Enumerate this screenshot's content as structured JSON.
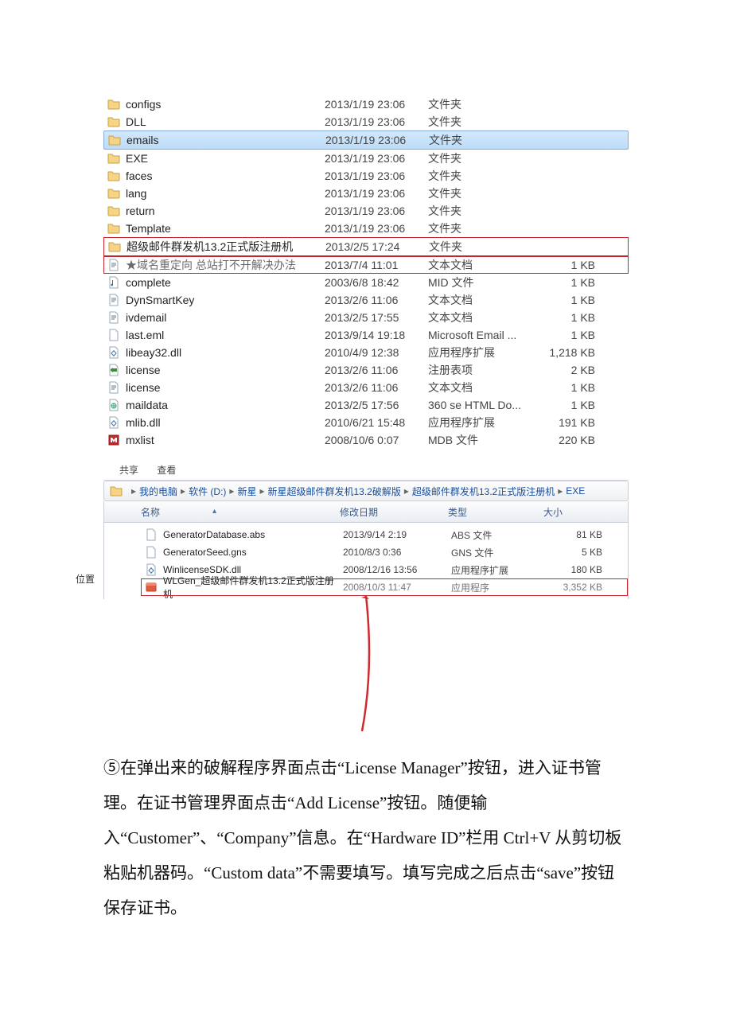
{
  "list1": {
    "rows": [
      {
        "icon": "folder",
        "name": "configs",
        "date": "2013/1/19 23:06",
        "type": "文件夹",
        "size": ""
      },
      {
        "icon": "folder",
        "name": "DLL",
        "date": "2013/1/19 23:06",
        "type": "文件夹",
        "size": ""
      },
      {
        "icon": "folder",
        "name": "emails",
        "date": "2013/1/19 23:06",
        "type": "文件夹",
        "size": "",
        "selected": true
      },
      {
        "icon": "folder",
        "name": "EXE",
        "date": "2013/1/19 23:06",
        "type": "文件夹",
        "size": ""
      },
      {
        "icon": "folder",
        "name": "faces",
        "date": "2013/1/19 23:06",
        "type": "文件夹",
        "size": ""
      },
      {
        "icon": "folder",
        "name": "lang",
        "date": "2013/1/19 23:06",
        "type": "文件夹",
        "size": ""
      },
      {
        "icon": "folder",
        "name": "return",
        "date": "2013/1/19 23:06",
        "type": "文件夹",
        "size": ""
      },
      {
        "icon": "folder",
        "name": "Template",
        "date": "2013/1/19 23:06",
        "type": "文件夹",
        "size": ""
      },
      {
        "icon": "folder",
        "name": "超级邮件群发机13.2正式版注册机",
        "date": "2013/2/5 17:24",
        "type": "文件夹",
        "size": "",
        "redbox": true
      },
      {
        "icon": "text",
        "name": "★域名重定向 总站打不开解决办法",
        "date": "2013/7/4 11:01",
        "type": "文本文档",
        "size": "1 KB",
        "boxed": true
      },
      {
        "icon": "midi",
        "name": "complete",
        "date": "2003/6/8 18:42",
        "type": "MID 文件",
        "size": "1 KB"
      },
      {
        "icon": "text",
        "name": "DynSmartKey",
        "date": "2013/2/6 11:06",
        "type": "文本文档",
        "size": "1 KB"
      },
      {
        "icon": "text",
        "name": "ivdemail",
        "date": "2013/2/5 17:55",
        "type": "文本文档",
        "size": "1 KB"
      },
      {
        "icon": "file",
        "name": "last.eml",
        "date": "2013/9/14 19:18",
        "type": "Microsoft Email ...",
        "size": "1 KB"
      },
      {
        "icon": "dll",
        "name": "libeay32.dll",
        "date": "2010/4/9 12:38",
        "type": "应用程序扩展",
        "size": "1,218 KB"
      },
      {
        "icon": "reg",
        "name": "license",
        "date": "2013/2/6 11:06",
        "type": "注册表项",
        "size": "2 KB"
      },
      {
        "icon": "text",
        "name": "license",
        "date": "2013/2/6 11:06",
        "type": "文本文档",
        "size": "1 KB"
      },
      {
        "icon": "html",
        "name": "maildata",
        "date": "2013/2/5 17:56",
        "type": "360 se HTML Do...",
        "size": "1 KB"
      },
      {
        "icon": "dll",
        "name": "mlib.dll",
        "date": "2010/6/21 15:48",
        "type": "应用程序扩展",
        "size": "191 KB"
      },
      {
        "icon": "mdb",
        "name": "mxlist",
        "date": "2008/10/6 0:07",
        "type": "MDB 文件",
        "size": "220 KB"
      }
    ]
  },
  "toolbar": {
    "share": "共享",
    "view": "查看",
    "breadcrumb": [
      "我的电脑",
      "软件 (D:)",
      "新星",
      "新星超级邮件群发机13.2破解版",
      "超级邮件群发机13.2正式版注册机",
      "EXE"
    ]
  },
  "list2": {
    "side_label": "位置",
    "headers": {
      "name": "名称",
      "date": "修改日期",
      "type": "类型",
      "size": "大小"
    },
    "rows": [
      {
        "icon": "file",
        "name": "GeneratorDatabase.abs",
        "date": "2013/9/14 2:19",
        "type": "ABS 文件",
        "size": "81 KB"
      },
      {
        "icon": "file",
        "name": "GeneratorSeed.gns",
        "date": "2010/8/3 0:36",
        "type": "GNS 文件",
        "size": "5 KB"
      },
      {
        "icon": "dll",
        "name": "WinlicenseSDK.dll",
        "date": "2008/12/16 13:56",
        "type": "应用程序扩展",
        "size": "180 KB"
      },
      {
        "icon": "exe-red",
        "name": "WLGen_超级邮件群发机13.2正式版注册机",
        "date": "2008/10/3 11:47",
        "type": "应用程序",
        "size": "3,352 KB",
        "redbox": true
      }
    ]
  },
  "paragraph": "⑤在弹出来的破解程序界面点击“License Manager”按钮，进入证书管理。在证书管理界面点击“Add License”按钮。随便输入“Customer”、“Company”信息。在“Hardware ID”栏用 Ctrl+V 从剪切板粘贴机器码。“Custom data”不需要填写。填写完成之后点击“save”按钮保存证书。"
}
